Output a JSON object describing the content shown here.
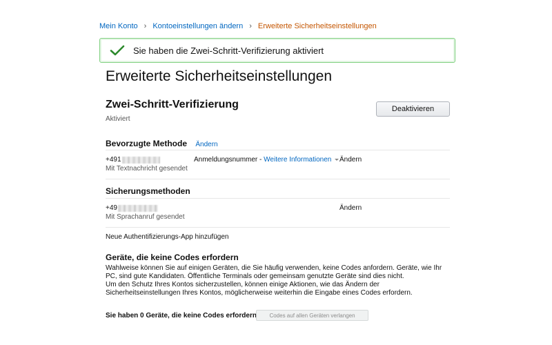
{
  "breadcrumb": {
    "items": [
      "Mein Konto",
      "Kontoeinstellungen ändern"
    ],
    "current": "Erweiterte Sicherheitseinstellungen",
    "separator": "›"
  },
  "alert": {
    "message": "Sie haben die Zwei-Schritt-Verifizierung aktiviert",
    "icon": "checkmark-icon",
    "color": "#2d8a2d"
  },
  "page": {
    "title": "Erweiterte Sicherheitseinstellungen"
  },
  "two_step": {
    "title": "Zwei-Schritt-Verifizierung",
    "status": "Aktiviert",
    "deactivate_label": "Deaktivieren"
  },
  "preferred": {
    "heading": "Bevorzugte Methode",
    "change_label": "Ändern",
    "phone_prefix": "+491",
    "method": "Mit Textnachricht gesendet",
    "login_number_label": "Anmeldungsnummer -",
    "more_info_label": "Weitere Informationen",
    "row_change_label": "Ändern"
  },
  "backup": {
    "heading": "Sicherungsmethoden",
    "phone_prefix": "+49",
    "method": "Mit Sprachanruf gesendet",
    "row_change_label": "Ändern"
  },
  "auth_app": {
    "label": "Neue Authentifizierungs-App hinzufügen"
  },
  "devices": {
    "heading": "Geräte, die keine Codes erfordern",
    "paragraph1": "Wahlweise können Sie auf einigen Geräten, die Sie häufig verwenden, keine Codes anfordern. Geräte, wie Ihr PC, sind gute Kandidaten. Öffentliche Terminals oder gemeinsam genutzte Geräte sind dies nicht.",
    "paragraph2": "Um den Schutz Ihres Kontos sicherzustellen, können einige Aktionen, wie das Ändern der Sicherheitseinstellungen Ihres Kontos, möglicherweise weiterhin die Eingabe eines Codes erfordern.",
    "count_text": "Sie haben 0 Geräte, die keine Codes erfordern",
    "require_codes_label": "Codes auf allen Geräten verlangen"
  },
  "colors": {
    "link": "#0066c0",
    "breadcrumb_current": "#c45500",
    "alert_border": "#7fd07f"
  }
}
